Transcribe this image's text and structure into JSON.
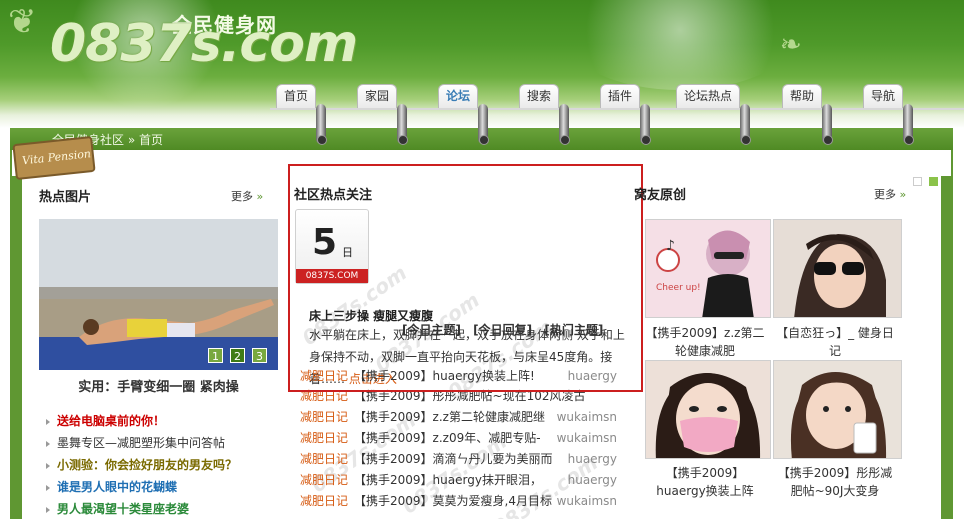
{
  "site": {
    "logo_text": "0837s.com",
    "logo_cn": "全民健身网"
  },
  "nav": {
    "tabs": [
      {
        "label": "首页"
      },
      {
        "label": "家园"
      },
      {
        "label": "论坛"
      },
      {
        "label": "搜索"
      },
      {
        "label": "插件"
      },
      {
        "label": "论坛热点"
      },
      {
        "label": "帮助"
      },
      {
        "label": "导航"
      }
    ],
    "active_tab": "论坛"
  },
  "breadcrumb": {
    "items": [
      "全民健身社区",
      "首页"
    ],
    "separator": "»"
  },
  "badge": {
    "text": "Vita Pension"
  },
  "hot_pictures": {
    "title": "热点图片",
    "more": "更多",
    "pages": [
      "1",
      "2",
      "3"
    ],
    "current_page": "2",
    "caption": "实用：手臂变细一圈 紧肉操",
    "list": [
      {
        "text": "送给电脑桌前的你！",
        "color": "#cc0000"
      },
      {
        "text": "墨舞专区—减肥塑形集中问答帖",
        "color": "#333333"
      },
      {
        "text": "小测验：你会捡好朋友的男友吗？",
        "color": "#7a6a00"
      },
      {
        "text": "谁是男人眼中的花蝴蝶",
        "color": "#1f6fb3"
      },
      {
        "text": "男人最渴望十类星座老婆",
        "color": "#2b8a3a"
      }
    ]
  },
  "community": {
    "title": "社区热点关注",
    "calendar_day": "5",
    "calendar_unit": "日",
    "calendar_site": "0837S.COM",
    "watermark": "0837s.com",
    "article_title": "床上三步操 瘦腿又瘦腹",
    "article_text": "水平躺在床上，双脚并在一起，双手放在身体两侧 双手和上身保持不动，双脚一直平抬向天花板，与床呈45度角。接着……",
    "read_more": "点击进入",
    "forum_tabs": [
      "[今日主题]",
      "[今日回复]",
      "[热门主题]"
    ],
    "posts": [
      {
        "cat": "减肥日记",
        "title": "【携手2009】huaergy换装上阵!",
        "author": "huaergy"
      },
      {
        "cat": "减肥日记",
        "title": "【携手2009】彤彤减肥帖~现在102风凌古",
        "author": ""
      },
      {
        "cat": "减肥日记",
        "title": "【携手2009】z.z第二轮健康减肥继",
        "author": "wukaimsn"
      },
      {
        "cat": "减肥日记",
        "title": "【携手2009】z.z09年、减肥专贴-",
        "author": "wukaimsn"
      },
      {
        "cat": "减肥日记",
        "title": "【携手2009】滴滴ㄣ丹儿要为美丽而",
        "author": "huaergy"
      },
      {
        "cat": "减肥日记",
        "title": "【携手2009】huaergy抹开眼泪，",
        "author": "huaergy"
      },
      {
        "cat": "减肥日记",
        "title": "【携手2009】莫莫为爱瘦身,4月目标",
        "author": "wukaimsn"
      }
    ]
  },
  "friends": {
    "title": "窝友原创",
    "more": "更多",
    "photos": [
      {
        "caption": "【携手2009】z.z第二轮健康减肥"
      },
      {
        "caption": "【自恋狂っ】_ 健身日记"
      },
      {
        "caption": "【携手2009】huaergy换装上阵"
      },
      {
        "caption": "【携手2009】彤彤减肥帖~90J大变身"
      }
    ],
    "photo_text": "Cheer up!"
  },
  "colors": {
    "brand_green": "#5f9732",
    "highlight_red": "#cc1f1f",
    "category_orange": "#d65b13"
  }
}
